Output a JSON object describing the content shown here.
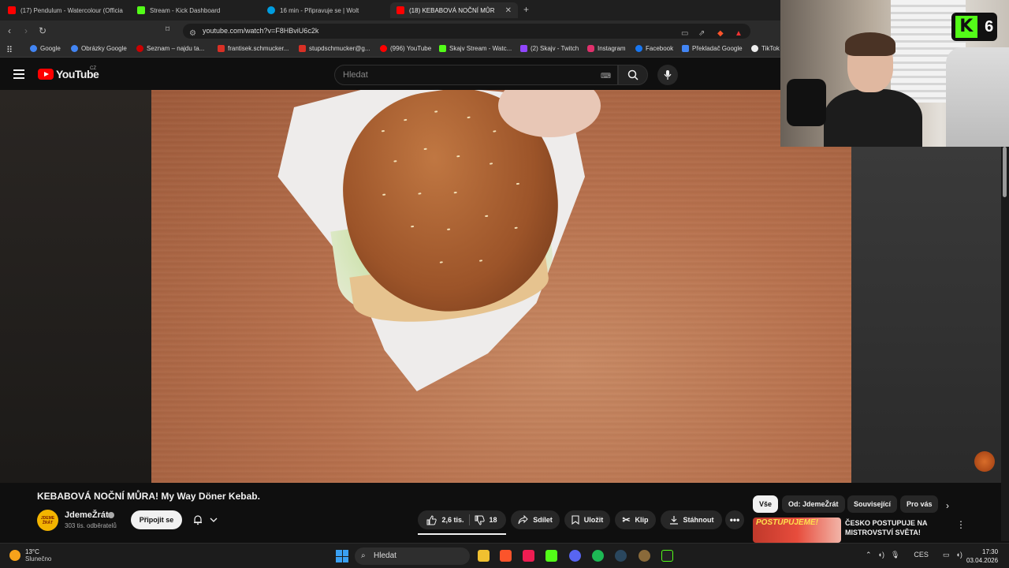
{
  "browser": {
    "tabs": [
      {
        "label": "(17) Pendulum - Watercolour (Officia",
        "favicon_color": "#ff0000"
      },
      {
        "label": "Stream - Kick Dashboard",
        "favicon_color": "#53fc18"
      },
      {
        "label": "16 min - Připravuje se | Wolt",
        "favicon_color": "#009de0"
      },
      {
        "label": "(18) KEBABOVÁ NOČNÍ MŮR",
        "favicon_color": "#ff0000"
      }
    ],
    "url": "youtube.com/watch?v=F8HBviU6c2k",
    "bookmarks": [
      {
        "label": "Google",
        "color": "#4285f4"
      },
      {
        "label": "Obrázky Google",
        "color": "#4285f4"
      },
      {
        "label": "Seznam – najdu ta...",
        "color": "#cc0000"
      },
      {
        "label": "frantisek.schmucker...",
        "color": "#d93025"
      },
      {
        "label": "stupdschmucker@g...",
        "color": "#d93025"
      },
      {
        "label": "(996) YouTube",
        "color": "#ff0000"
      },
      {
        "label": "Skajv Stream - Watc...",
        "color": "#53fc18"
      },
      {
        "label": "(2) Skajv - Twitch",
        "color": "#9146ff"
      },
      {
        "label": "Instagram",
        "color": "#e1306c"
      },
      {
        "label": "Facebook",
        "color": "#1877f2"
      },
      {
        "label": "Překladač Google",
        "color": "#4285f4"
      },
      {
        "label": "TikTok",
        "color": "#eeeeee"
      }
    ]
  },
  "youtube": {
    "logo_text": "YouTube",
    "region": "CZ",
    "search_placeholder": "Hledat"
  },
  "video": {
    "title": "KEBABOVÁ NOČNÍ MŮRA! My Way Döner Kebab.",
    "channel_name": "JdemeŽrát",
    "channel_avatar_text": "JDEME ŽRÁT",
    "subscribers": "303 tis. odběratelů",
    "join_label": "Připojit se",
    "likes": "2,6 tis.",
    "dislikes": "18",
    "share_label": "Sdílet",
    "save_label": "Uložit",
    "clip_label": "Klip",
    "download_label": "Stáhnout"
  },
  "chips": [
    {
      "label": "Vše",
      "active": true
    },
    {
      "label": "Od: JdemeŽrát",
      "active": false
    },
    {
      "label": "Související",
      "active": false
    },
    {
      "label": "Pro vás",
      "active": false
    }
  ],
  "recommendation": {
    "thumb_text": "POSTUPUJEME!",
    "title": "ČESKO POSTUPUJE NA MISTROVSTVÍ SVĚTA!"
  },
  "webcam_overlay": {
    "logo_letter": "K",
    "number": "6"
  },
  "taskbar": {
    "temperature": "13°C",
    "weather": "Slunečno",
    "search_label": "Hledat",
    "language": "CES",
    "time": "17:30",
    "date": "03.04.2026"
  }
}
